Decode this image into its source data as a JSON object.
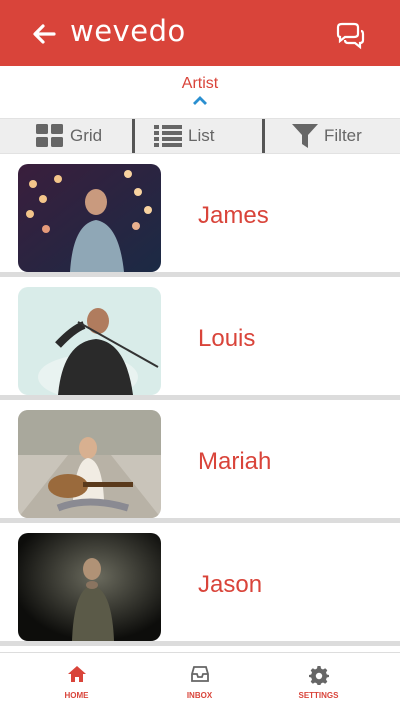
{
  "header": {
    "title": "wevedo",
    "back_icon": "arrow-left-icon",
    "chat_icon": "chat-bubbles-icon"
  },
  "section": {
    "label": "Artist"
  },
  "view_tabs": [
    {
      "label": "Grid",
      "icon": "grid-icon"
    },
    {
      "label": "List",
      "icon": "list-icon"
    },
    {
      "label": "Filter",
      "icon": "filter-icon"
    }
  ],
  "artists": [
    {
      "name": "James"
    },
    {
      "name": "Louis"
    },
    {
      "name": "Mariah"
    },
    {
      "name": "Jason"
    }
  ],
  "bottom_nav": [
    {
      "label": "HOME",
      "icon": "home-icon"
    },
    {
      "label": "INBOX",
      "icon": "inbox-icon"
    },
    {
      "label": "SETTINGS",
      "icon": "gear-icon"
    }
  ],
  "colors": {
    "brand": "#d9443a",
    "accent": "#2a8fd0"
  }
}
